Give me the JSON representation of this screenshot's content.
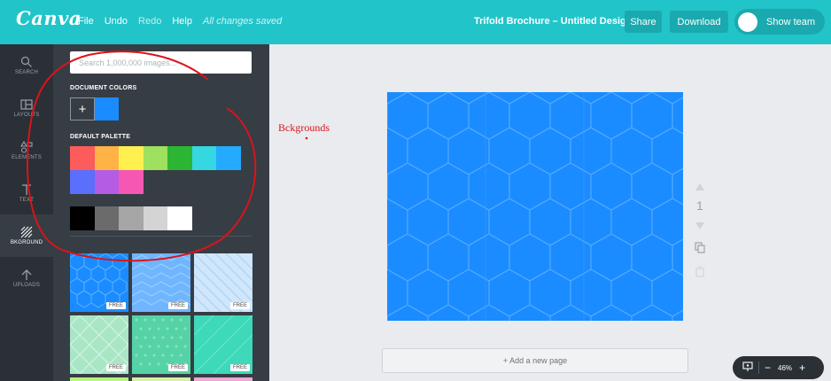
{
  "app": {
    "logo": "Canva",
    "menu": {
      "file": "File",
      "undo": "Undo",
      "redo": "Redo",
      "help": "Help",
      "saved_status": "All changes saved"
    },
    "document_title": "Trifold Brochure – Untitled Design",
    "share_label": "Share",
    "download_label": "Download",
    "team_label": "Show team"
  },
  "rail": {
    "items": [
      {
        "label": "SEARCH",
        "icon": "search-icon"
      },
      {
        "label": "LAYOUTS",
        "icon": "layouts-icon"
      },
      {
        "label": "ELEMENTS",
        "icon": "elements-icon"
      },
      {
        "label": "TEXT",
        "icon": "text-icon"
      },
      {
        "label": "BKGROUND",
        "icon": "background-icon"
      },
      {
        "label": "UPLOADS",
        "icon": "upload-icon"
      }
    ]
  },
  "panel": {
    "search_placeholder": "Search 1,000,000 images...",
    "document_colors_label": "DOCUMENT COLORS",
    "add_color_symbol": "+",
    "document_colors": [
      "#1a8cff"
    ],
    "default_palette_label": "DEFAULT PALETTE",
    "palette_row1": [
      "#fd5c5c",
      "#ffb347",
      "#fff04f",
      "#9fe05f",
      "#2bb533",
      "#35d7e0",
      "#24aaff"
    ],
    "palette_row2": [
      "#5a6ffb",
      "#b45ce4",
      "#f557b2"
    ],
    "grays": [
      "#000000",
      "#6b6b6b",
      "#a6a6a6",
      "#d4d4d4",
      "#ffffff"
    ],
    "thumbs": [
      {
        "pattern": "hexagons",
        "bg": "#1a8cff",
        "badge": "FREE"
      },
      {
        "pattern": "chevrons",
        "bg": "#6fb6ff",
        "badge": "FREE"
      },
      {
        "pattern": "diagonals",
        "bg": "#cfe6fb",
        "badge": "FREE"
      },
      {
        "pattern": "diamonds",
        "bg": "#a9e6c6",
        "badge": "FREE"
      },
      {
        "pattern": "dots",
        "bg": "#56d3a6",
        "badge": "FREE"
      },
      {
        "pattern": "triangles",
        "bg": "#3dd9b8",
        "badge": "FREE"
      }
    ]
  },
  "canvas": {
    "background_color": "#1a8cff",
    "page_number": "1",
    "add_page_label": "+ Add a new page"
  },
  "zoom": {
    "level": "46%",
    "minus": "−",
    "plus": "+"
  },
  "annotation": {
    "text": "Bckgrounds",
    "color": "#d8141c"
  }
}
